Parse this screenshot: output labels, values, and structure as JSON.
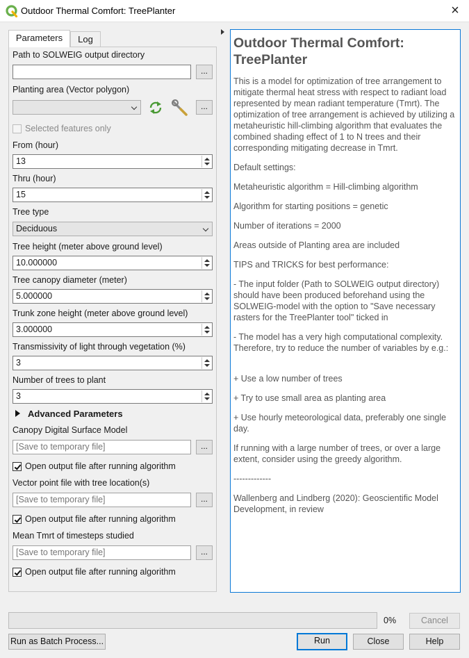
{
  "window": {
    "title": "Outdoor Thermal Comfort: TreePlanter",
    "close_icon": "×"
  },
  "tabs": [
    {
      "label": "Parameters"
    },
    {
      "label": "Log"
    }
  ],
  "params": {
    "solweig_dir": {
      "label": "Path to SOLWEIG output directory",
      "value": ""
    },
    "planting_area": {
      "label": "Planting area (Vector polygon)",
      "value": ""
    },
    "selected_only": {
      "label": "Selected features only",
      "checked": false
    },
    "from_hour": {
      "label": "From (hour)",
      "value": "13"
    },
    "thru_hour": {
      "label": "Thru (hour)",
      "value": "15"
    },
    "tree_type": {
      "label": "Tree type",
      "value": "Deciduous"
    },
    "tree_height": {
      "label": "Tree height (meter above ground level)",
      "value": "10.000000"
    },
    "canopy_diameter": {
      "label": "Tree canopy diameter (meter)",
      "value": "5.000000"
    },
    "trunk_height": {
      "label": "Trunk zone height (meter above ground level)",
      "value": "3.000000"
    },
    "transmissivity": {
      "label": "Transmissivity of light through vegetation (%)",
      "value": "3"
    },
    "num_trees": {
      "label": "Number of trees to plant",
      "value": "3"
    },
    "advanced": {
      "label": "Advanced Parameters"
    },
    "canopy_dsm": {
      "label": "Canopy Digital Surface Model",
      "placeholder": "[Save to temporary file]",
      "open_label": "Open output file after running algorithm",
      "open_checked": true
    },
    "tree_points": {
      "label": "Vector point file with tree location(s)",
      "placeholder": "[Save to temporary file]",
      "open_label": "Open output file after running algorithm",
      "open_checked": true
    },
    "mean_tmrt": {
      "label": "Mean Tmrt of timesteps studied",
      "placeholder": "[Save to temporary file]",
      "open_label": "Open output file after running algorithm",
      "open_checked": true
    },
    "browse_label": "..."
  },
  "help": {
    "title": "Outdoor Thermal Comfort: TreePlanter",
    "paragraphs": [
      "This is a model for optimization of tree arrangement to mitigate thermal heat stress with respect to radiant load represented by mean radiant temperature (Tmrt). The optimization of tree arrangement is achieved by utilizing a metaheuristic hill-climbing algorithm that evaluates the combined shading effect of 1 to N trees and their corresponding mitigating decrease in Tmrt.",
      "Default settings:",
      "Metaheuristic algorithm = Hill-climbing algorithm",
      "Algorithm for starting positions = genetic",
      "Number of iterations = 2000",
      "Areas outside of Planting area are included",
      "TIPS and TRICKS for best performance:",
      "- The input folder (Path to SOLWEIG output directory) should have been produced beforehand using the SOLWEIG-model with the option to \"Save necessary rasters for the TreePlanter tool\" ticked in",
      "- The model has a very high computational complexity. Therefore, try to reduce the number of variables by e.g.:",
      "+ Use a low number of trees",
      "+ Try to use small area as planting area",
      "+ Use hourly meteorological data, preferably one single day.",
      "If running with a large number of trees, or over a large extent, consider using the greedy algorithm.",
      "-------------",
      "Wallenberg and Lindberg (2020): Geoscientific Model Development, in review"
    ]
  },
  "footer": {
    "progress": 0,
    "progress_text": "0%",
    "cancel": "Cancel",
    "batch": "Run as Batch Process...",
    "run": "Run",
    "close": "Close",
    "help": "Help"
  },
  "colors": {
    "accent": "#0078d7",
    "qgis_green": "#6ab04c"
  }
}
